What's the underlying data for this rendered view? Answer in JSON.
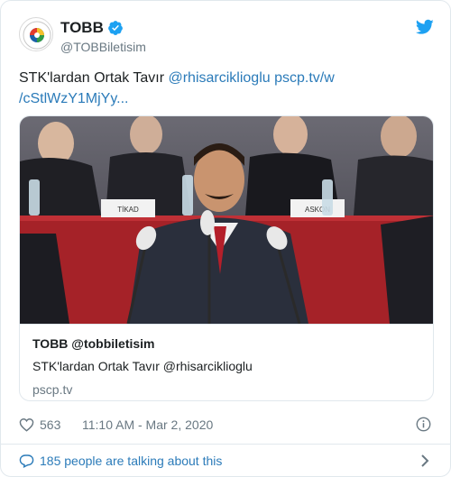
{
  "author": {
    "display_name": "TOBB",
    "handle": "@TOBBiletisim"
  },
  "tweet": {
    "text_plain": "STK'lardan Ortak Tavır ",
    "mention": "@rhisarciklioglu",
    "link_line1": "pscp.tv/w",
    "link_line2": "/cStlWzY1MjYy..."
  },
  "card": {
    "title": "TOBB @tobbiletisim",
    "description": "STK'lardan Ortak Tavır @rhisarciklioglu",
    "domain": "pscp.tv",
    "nameplates": [
      "TİKAD",
      "ASKON"
    ]
  },
  "meta": {
    "likes": "563",
    "timestamp": "11:10 AM - Mar 2, 2020"
  },
  "footer": {
    "talking": "185 people are talking about this"
  },
  "colors": {
    "link": "#2b7bb9",
    "secondary_text": "#697882",
    "border": "#e1e8ed",
    "verified": "#1da1f2",
    "bird": "#1da1f2"
  }
}
